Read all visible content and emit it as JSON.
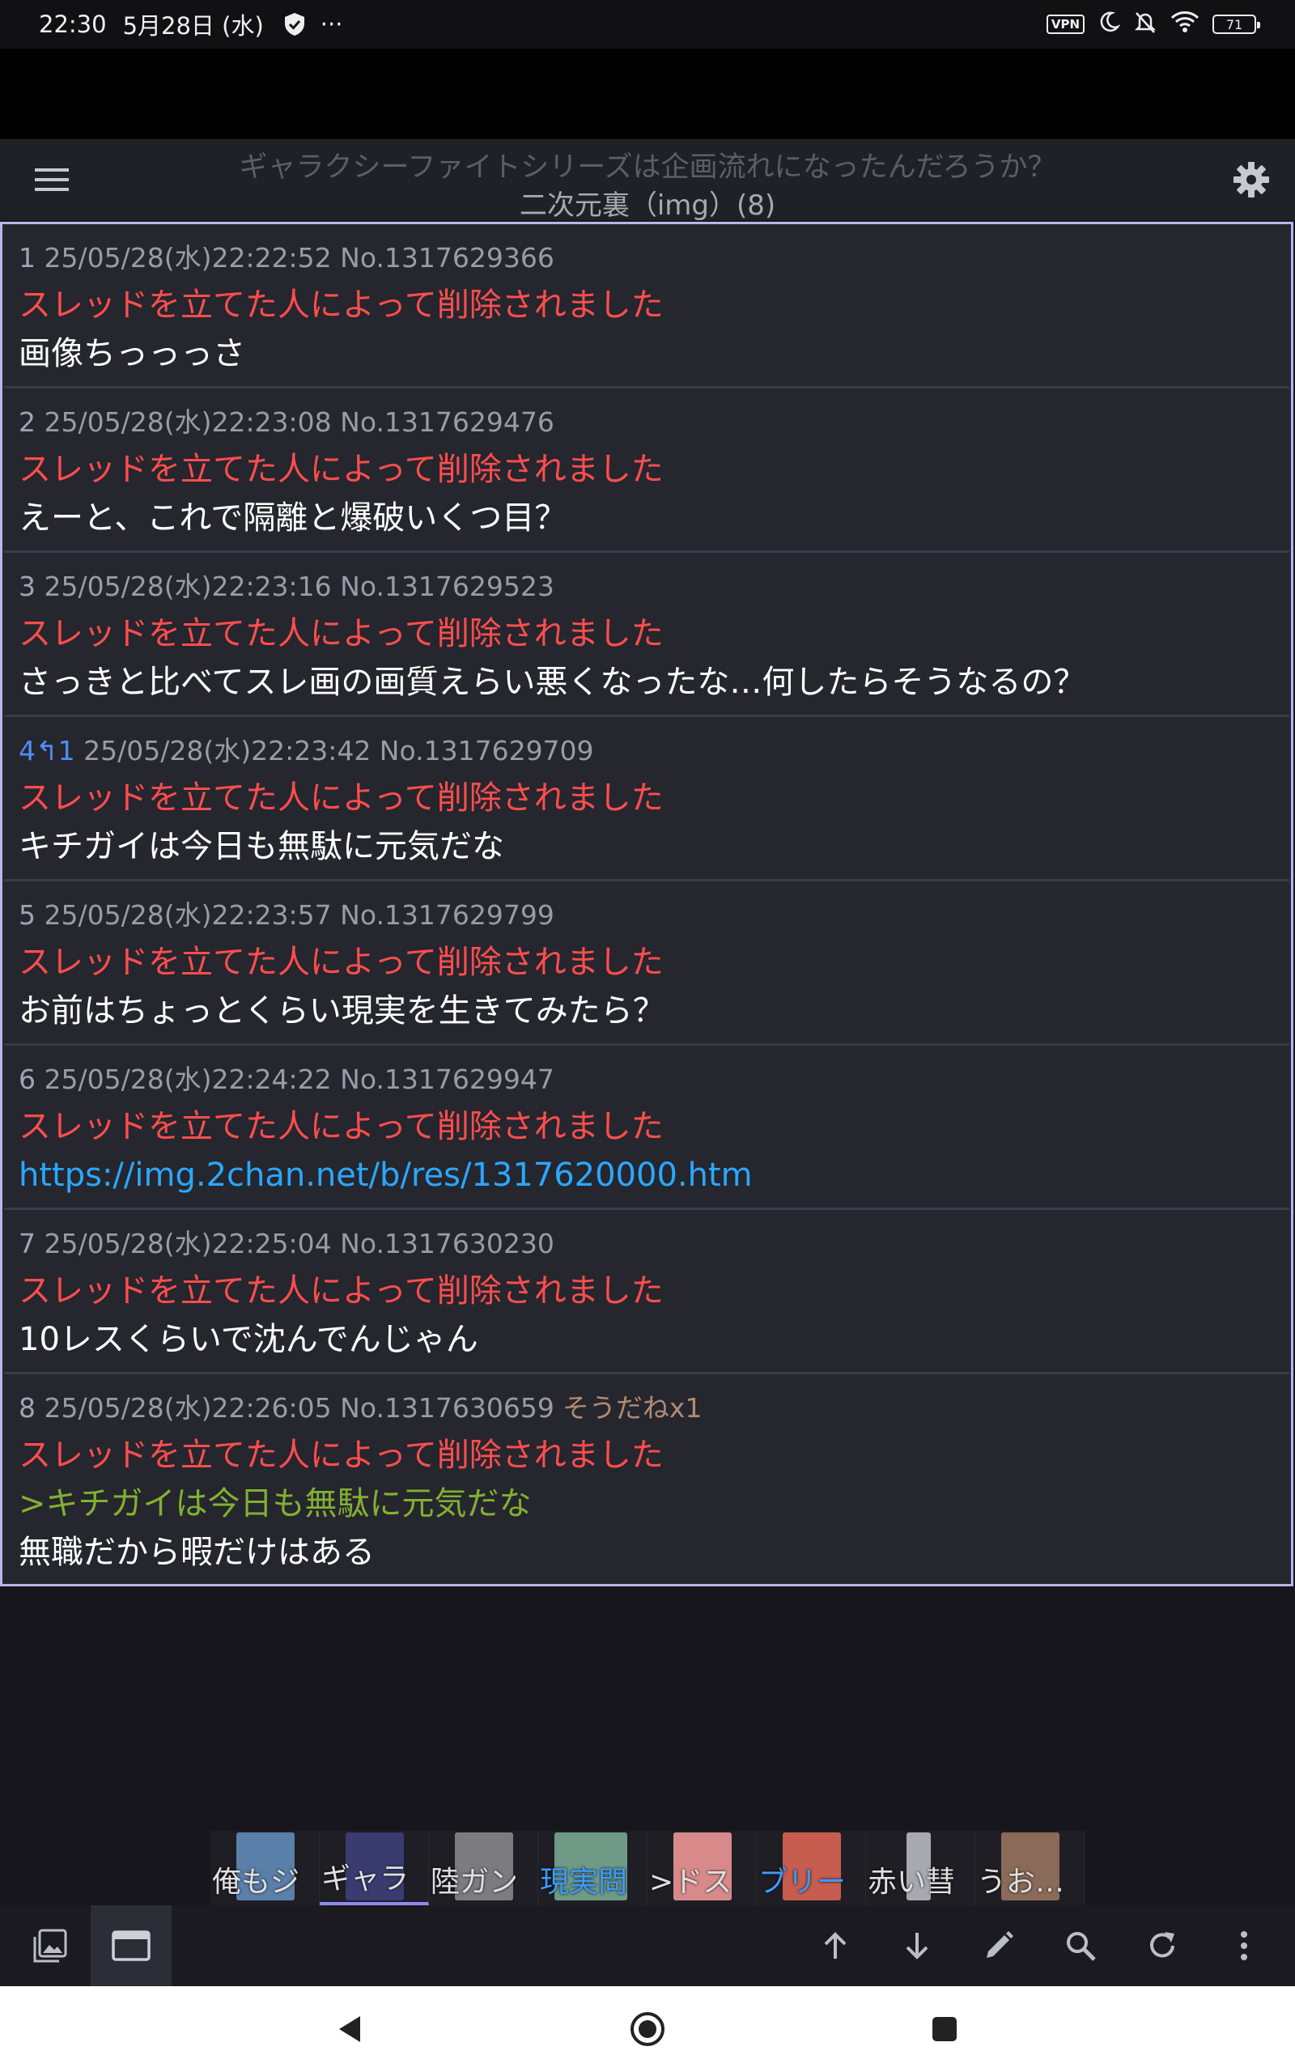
{
  "status_bar": {
    "time": "22:30",
    "date": "5月28日 (水)",
    "more": "···",
    "vpn": "VPN",
    "battery": "71"
  },
  "header": {
    "title": "ギャラクシーファイトシリーズは企画流れになったんだろうか？",
    "subtitle": "二次元裏（img）(8)"
  },
  "deleted_text": "スレッドを立てた人によって削除されました",
  "posts": [
    {
      "num": "1",
      "meta": " 25/05/28(水)22:22:52 No.1317629366",
      "deleted": "スレッドを立てた人によって削除されました",
      "body": "画像ちっっっさ"
    },
    {
      "num": "2",
      "meta": " 25/05/28(水)22:23:08 No.1317629476",
      "deleted": "スレッドを立てた人によって削除されました",
      "body": "えーと、これで隔離と爆破いくつ目？"
    },
    {
      "num": "3",
      "meta": " 25/05/28(水)22:23:16 No.1317629523",
      "deleted": "スレッドを立てた人によって削除されました",
      "body": "さっきと比べてスレ画の画質えらい悪くなったな…何したらそうなるの？"
    },
    {
      "num": "4",
      "reply_arrow": "↰",
      "reply_count": "1",
      "meta": " 25/05/28(水)22:23:42 No.1317629709",
      "deleted": "スレッドを立てた人によって削除されました",
      "body": "キチガイは今日も無駄に元気だな"
    },
    {
      "num": "5",
      "meta": " 25/05/28(水)22:23:57 No.1317629799",
      "deleted": "スレッドを立てた人によって削除されました",
      "body": "お前はちょっとくらい現実を生きてみたら？"
    },
    {
      "num": "6",
      "meta": " 25/05/28(水)22:24:22 No.1317629947",
      "deleted": "スレッドを立てた人によって削除されました",
      "link": "https://img.2chan.net/b/res/1317620000.htm"
    },
    {
      "num": "7",
      "meta": " 25/05/28(水)22:25:04 No.1317630230",
      "deleted": "スレッドを立てた人によって削除されました",
      "body": "10レスくらいで沈んでんじゃん"
    },
    {
      "num": "8",
      "meta": " 25/05/28(水)22:26:05 No.1317630659",
      "sodane": "そうだねx1",
      "deleted": "スレッドを立てた人によって削除されました",
      "quote": ">キチガイは今日も無駄に元気だな",
      "body": "無職だから暇だけはある"
    }
  ],
  "tabs": [
    {
      "label": "俺もジ",
      "thumb_color": "#5a7fa8",
      "blue": false
    },
    {
      "label": "ギャラ",
      "thumb_color": "#3a3b6e",
      "blue": false,
      "active": true
    },
    {
      "label": "陸ガン",
      "thumb_color": "#7b7b80",
      "blue": false
    },
    {
      "label": "現実問",
      "thumb_color": "#6f9a86",
      "blue": true
    },
    {
      "label": ">ドス",
      "thumb_color": "#d88a8a",
      "blue": false
    },
    {
      "label": "ブリー",
      "thumb_color": "#c65d4e",
      "blue": true
    },
    {
      "label": "赤い彗",
      "thumb_color": "#a8a8b0",
      "blue": false
    },
    {
      "label": "うお…",
      "thumb_color": "#8a6a58",
      "blue": false
    }
  ],
  "toolbar": {
    "left": [
      "image-gallery",
      "window-tabs"
    ],
    "right": [
      "scroll-up",
      "scroll-down",
      "write-post",
      "search",
      "reload",
      "more"
    ]
  },
  "colors": {
    "deleted": "#ff4d4d",
    "quote": "#82b032",
    "link": "#2aa8ff",
    "reply_num": "#4f8ef7",
    "thread_border": "#b6b6ec"
  }
}
